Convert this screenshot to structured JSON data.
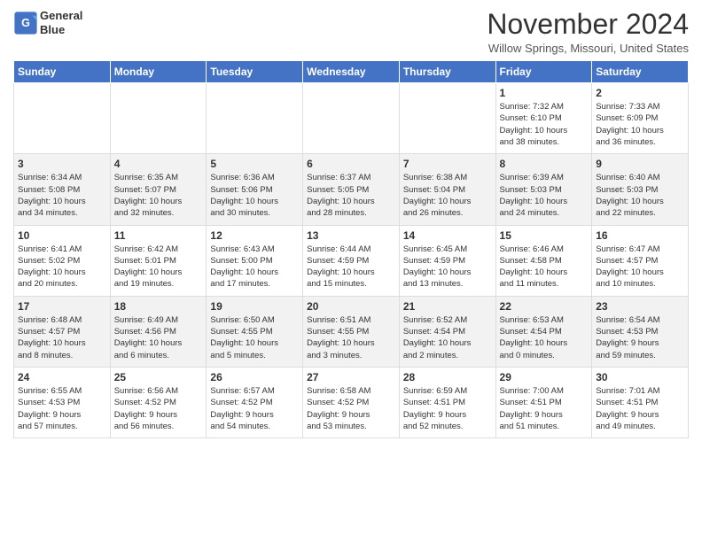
{
  "header": {
    "logo_line1": "General",
    "logo_line2": "Blue",
    "month": "November 2024",
    "location": "Willow Springs, Missouri, United States"
  },
  "days_of_week": [
    "Sunday",
    "Monday",
    "Tuesday",
    "Wednesday",
    "Thursday",
    "Friday",
    "Saturday"
  ],
  "weeks": [
    [
      {
        "day": "",
        "info": ""
      },
      {
        "day": "",
        "info": ""
      },
      {
        "day": "",
        "info": ""
      },
      {
        "day": "",
        "info": ""
      },
      {
        "day": "",
        "info": ""
      },
      {
        "day": "1",
        "info": "Sunrise: 7:32 AM\nSunset: 6:10 PM\nDaylight: 10 hours\nand 38 minutes."
      },
      {
        "day": "2",
        "info": "Sunrise: 7:33 AM\nSunset: 6:09 PM\nDaylight: 10 hours\nand 36 minutes."
      }
    ],
    [
      {
        "day": "3",
        "info": "Sunrise: 6:34 AM\nSunset: 5:08 PM\nDaylight: 10 hours\nand 34 minutes."
      },
      {
        "day": "4",
        "info": "Sunrise: 6:35 AM\nSunset: 5:07 PM\nDaylight: 10 hours\nand 32 minutes."
      },
      {
        "day": "5",
        "info": "Sunrise: 6:36 AM\nSunset: 5:06 PM\nDaylight: 10 hours\nand 30 minutes."
      },
      {
        "day": "6",
        "info": "Sunrise: 6:37 AM\nSunset: 5:05 PM\nDaylight: 10 hours\nand 28 minutes."
      },
      {
        "day": "7",
        "info": "Sunrise: 6:38 AM\nSunset: 5:04 PM\nDaylight: 10 hours\nand 26 minutes."
      },
      {
        "day": "8",
        "info": "Sunrise: 6:39 AM\nSunset: 5:03 PM\nDaylight: 10 hours\nand 24 minutes."
      },
      {
        "day": "9",
        "info": "Sunrise: 6:40 AM\nSunset: 5:03 PM\nDaylight: 10 hours\nand 22 minutes."
      }
    ],
    [
      {
        "day": "10",
        "info": "Sunrise: 6:41 AM\nSunset: 5:02 PM\nDaylight: 10 hours\nand 20 minutes."
      },
      {
        "day": "11",
        "info": "Sunrise: 6:42 AM\nSunset: 5:01 PM\nDaylight: 10 hours\nand 19 minutes."
      },
      {
        "day": "12",
        "info": "Sunrise: 6:43 AM\nSunset: 5:00 PM\nDaylight: 10 hours\nand 17 minutes."
      },
      {
        "day": "13",
        "info": "Sunrise: 6:44 AM\nSunset: 4:59 PM\nDaylight: 10 hours\nand 15 minutes."
      },
      {
        "day": "14",
        "info": "Sunrise: 6:45 AM\nSunset: 4:59 PM\nDaylight: 10 hours\nand 13 minutes."
      },
      {
        "day": "15",
        "info": "Sunrise: 6:46 AM\nSunset: 4:58 PM\nDaylight: 10 hours\nand 11 minutes."
      },
      {
        "day": "16",
        "info": "Sunrise: 6:47 AM\nSunset: 4:57 PM\nDaylight: 10 hours\nand 10 minutes."
      }
    ],
    [
      {
        "day": "17",
        "info": "Sunrise: 6:48 AM\nSunset: 4:57 PM\nDaylight: 10 hours\nand 8 minutes."
      },
      {
        "day": "18",
        "info": "Sunrise: 6:49 AM\nSunset: 4:56 PM\nDaylight: 10 hours\nand 6 minutes."
      },
      {
        "day": "19",
        "info": "Sunrise: 6:50 AM\nSunset: 4:55 PM\nDaylight: 10 hours\nand 5 minutes."
      },
      {
        "day": "20",
        "info": "Sunrise: 6:51 AM\nSunset: 4:55 PM\nDaylight: 10 hours\nand 3 minutes."
      },
      {
        "day": "21",
        "info": "Sunrise: 6:52 AM\nSunset: 4:54 PM\nDaylight: 10 hours\nand 2 minutes."
      },
      {
        "day": "22",
        "info": "Sunrise: 6:53 AM\nSunset: 4:54 PM\nDaylight: 10 hours\nand 0 minutes."
      },
      {
        "day": "23",
        "info": "Sunrise: 6:54 AM\nSunset: 4:53 PM\nDaylight: 9 hours\nand 59 minutes."
      }
    ],
    [
      {
        "day": "24",
        "info": "Sunrise: 6:55 AM\nSunset: 4:53 PM\nDaylight: 9 hours\nand 57 minutes."
      },
      {
        "day": "25",
        "info": "Sunrise: 6:56 AM\nSunset: 4:52 PM\nDaylight: 9 hours\nand 56 minutes."
      },
      {
        "day": "26",
        "info": "Sunrise: 6:57 AM\nSunset: 4:52 PM\nDaylight: 9 hours\nand 54 minutes."
      },
      {
        "day": "27",
        "info": "Sunrise: 6:58 AM\nSunset: 4:52 PM\nDaylight: 9 hours\nand 53 minutes."
      },
      {
        "day": "28",
        "info": "Sunrise: 6:59 AM\nSunset: 4:51 PM\nDaylight: 9 hours\nand 52 minutes."
      },
      {
        "day": "29",
        "info": "Sunrise: 7:00 AM\nSunset: 4:51 PM\nDaylight: 9 hours\nand 51 minutes."
      },
      {
        "day": "30",
        "info": "Sunrise: 7:01 AM\nSunset: 4:51 PM\nDaylight: 9 hours\nand 49 minutes."
      }
    ]
  ]
}
